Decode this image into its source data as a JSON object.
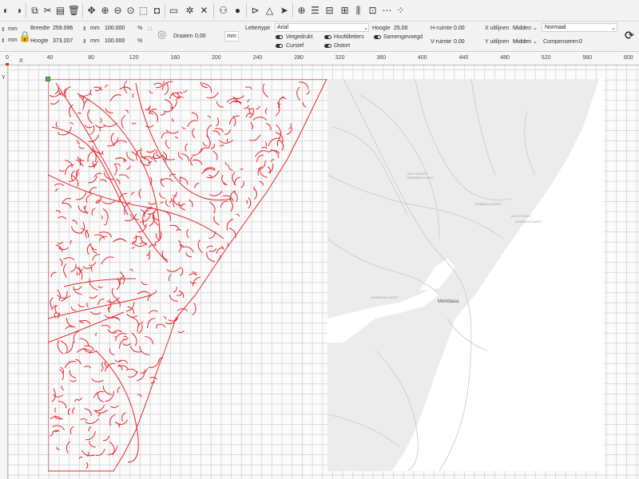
{
  "toolbar": {
    "icons": [
      "new-file-icon",
      "open-file-icon",
      "copy-icon",
      "cut-icon",
      "paste-icon",
      "delete-icon",
      "move-icon",
      "zoom-in-icon",
      "zoom-out-icon",
      "zoom-fit-icon",
      "select-all-icon",
      "camera-icon",
      "monitor-icon",
      "settings-icon",
      "tools-icon",
      "group-icon",
      "user-icon",
      "mirror-icon",
      "flip-icon",
      "send-icon",
      "target-icon",
      "align-icon",
      "distribute-icon",
      "align-center-icon",
      "spacing-icon",
      "grid-icon",
      "nudge-icon"
    ]
  },
  "props": {
    "unit_mm": "mm",
    "width_label": "Breedte",
    "width_value": "259.096",
    "height_label": "Hoogte",
    "height_value": "373.207",
    "scale_w": "100.000",
    "scale_h": "100.000",
    "percent": "%",
    "rotate_label": "Draaien",
    "rotate_value": "0,00",
    "mm_button": "mm",
    "font_label": "Lettertype",
    "font_value": "Arial",
    "font_height_label": "Hoogte",
    "font_height_value": "25.00",
    "hspace_label": "H-ruimte",
    "hspace_value": "0.00",
    "vspace_label": "V-ruimte",
    "vspace_value": "0.00",
    "x_align_label": "X uitlijnen",
    "x_align_value": "Midden",
    "y_align_label": "Y uitlijnen",
    "y_align_value": "Midden",
    "style_value": "Normaal",
    "compensate_label": "Compenseren",
    "compensate_value": "0",
    "bold_label": "Vetgedrukt",
    "caps_label": "Hoofdletters",
    "merge_label": "Samengevoegd",
    "italic_label": "Cursief",
    "distort_label": "Distort"
  },
  "ruler": {
    "x_axis": "X",
    "y_axis": "Y",
    "ticks": [
      "0",
      "40",
      "80",
      "120",
      "160",
      "200",
      "240",
      "280",
      "320",
      "360",
      "400",
      "440",
      "480",
      "520",
      "560",
      "600"
    ]
  },
  "map": {
    "city": "Mombasa",
    "county_labels": [
      "KILIFI COUNTY",
      "MOMBASA COUNTY",
      "MOMBASA COUNTY",
      "KILIFI COUNTY",
      "MOMBASA COUNTY",
      "MOMBASA COUNTY"
    ]
  },
  "colors": {
    "trace": "#e8262b",
    "map_bg": "#ececec",
    "selection": "#4caf50"
  }
}
